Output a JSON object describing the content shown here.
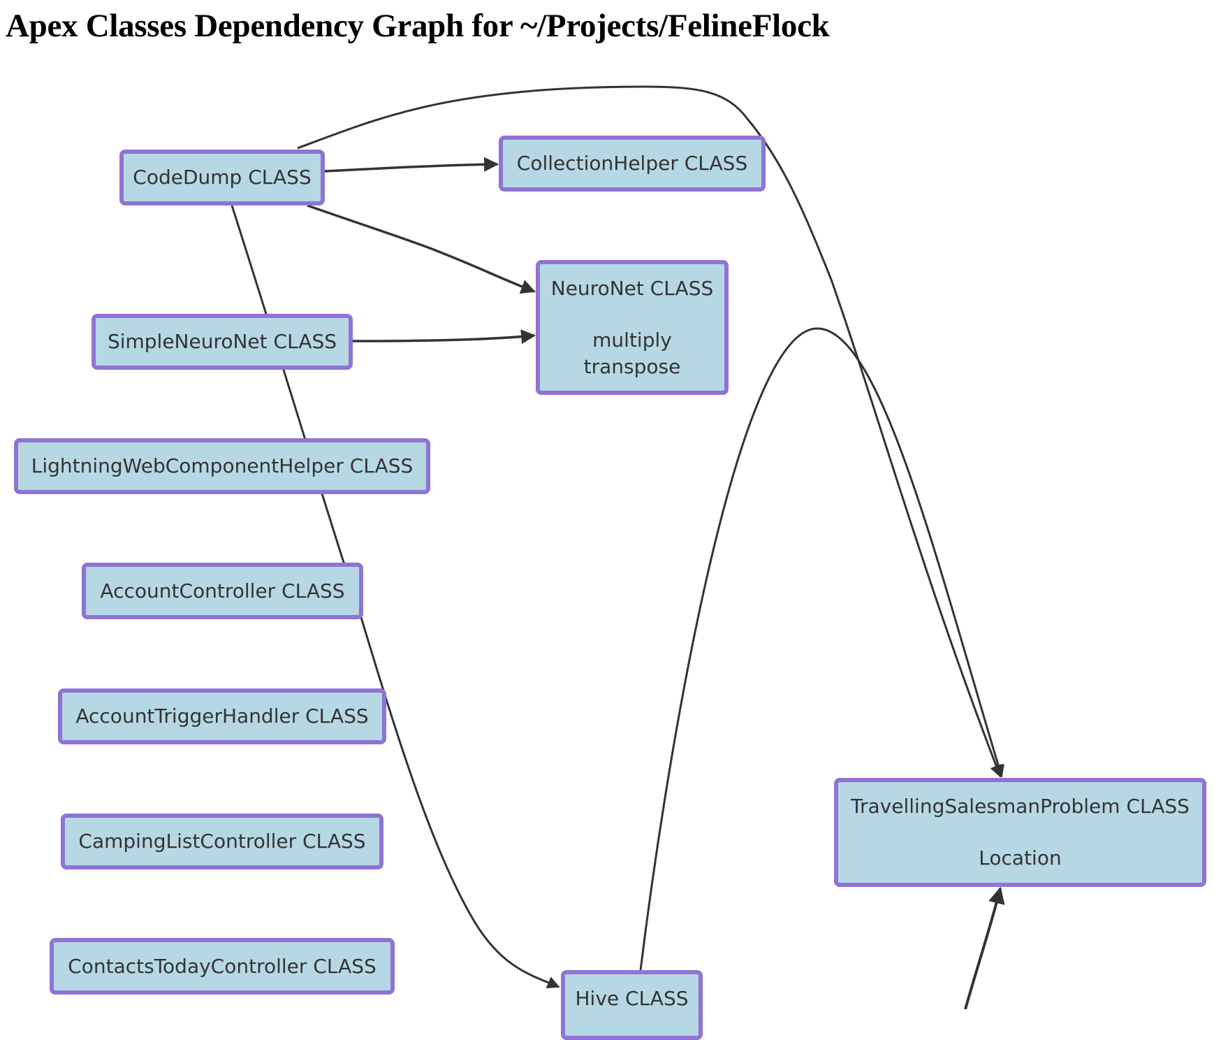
{
  "title": "Apex Classes Dependency Graph for ~/Projects/FelineFlock",
  "colors": {
    "node_fill": "#b6d8e4",
    "node_border": "#9073d4",
    "edge": "#333333",
    "text": "#333333"
  },
  "nodes": {
    "codedump": {
      "label": "CodeDump CLASS",
      "members": []
    },
    "collection": {
      "label": "CollectionHelper CLASS",
      "members": []
    },
    "neuronet": {
      "label": "NeuroNet CLASS",
      "members": [
        "multiply",
        "transpose"
      ]
    },
    "simpleneuronet": {
      "label": "SimpleNeuroNet CLASS",
      "members": []
    },
    "lwchelper": {
      "label": "LightningWebComponentHelper CLASS",
      "members": []
    },
    "accountctrl": {
      "label": "AccountController CLASS",
      "members": []
    },
    "triggerhandler": {
      "label": "AccountTriggerHandler CLASS",
      "members": []
    },
    "campinglist": {
      "label": "CampingListController CLASS",
      "members": []
    },
    "contactstoday": {
      "label": "ContactsTodayController CLASS",
      "members": []
    },
    "hive": {
      "label": "Hive CLASS",
      "members": []
    },
    "tsp": {
      "label": "TravellingSalesmanProblem CLASS",
      "members": [
        "Location"
      ]
    }
  },
  "edges": [
    {
      "from": "codedump",
      "to": "collection"
    },
    {
      "from": "codedump",
      "to": "neuronet"
    },
    {
      "from": "codedump",
      "to": "tsp"
    },
    {
      "from": "codedump",
      "to": "hive"
    },
    {
      "from": "simpleneuronet",
      "to": "neuronet"
    },
    {
      "from": "hive",
      "to": "tsp"
    },
    {
      "from": "offscreen",
      "to": "tsp"
    }
  ]
}
